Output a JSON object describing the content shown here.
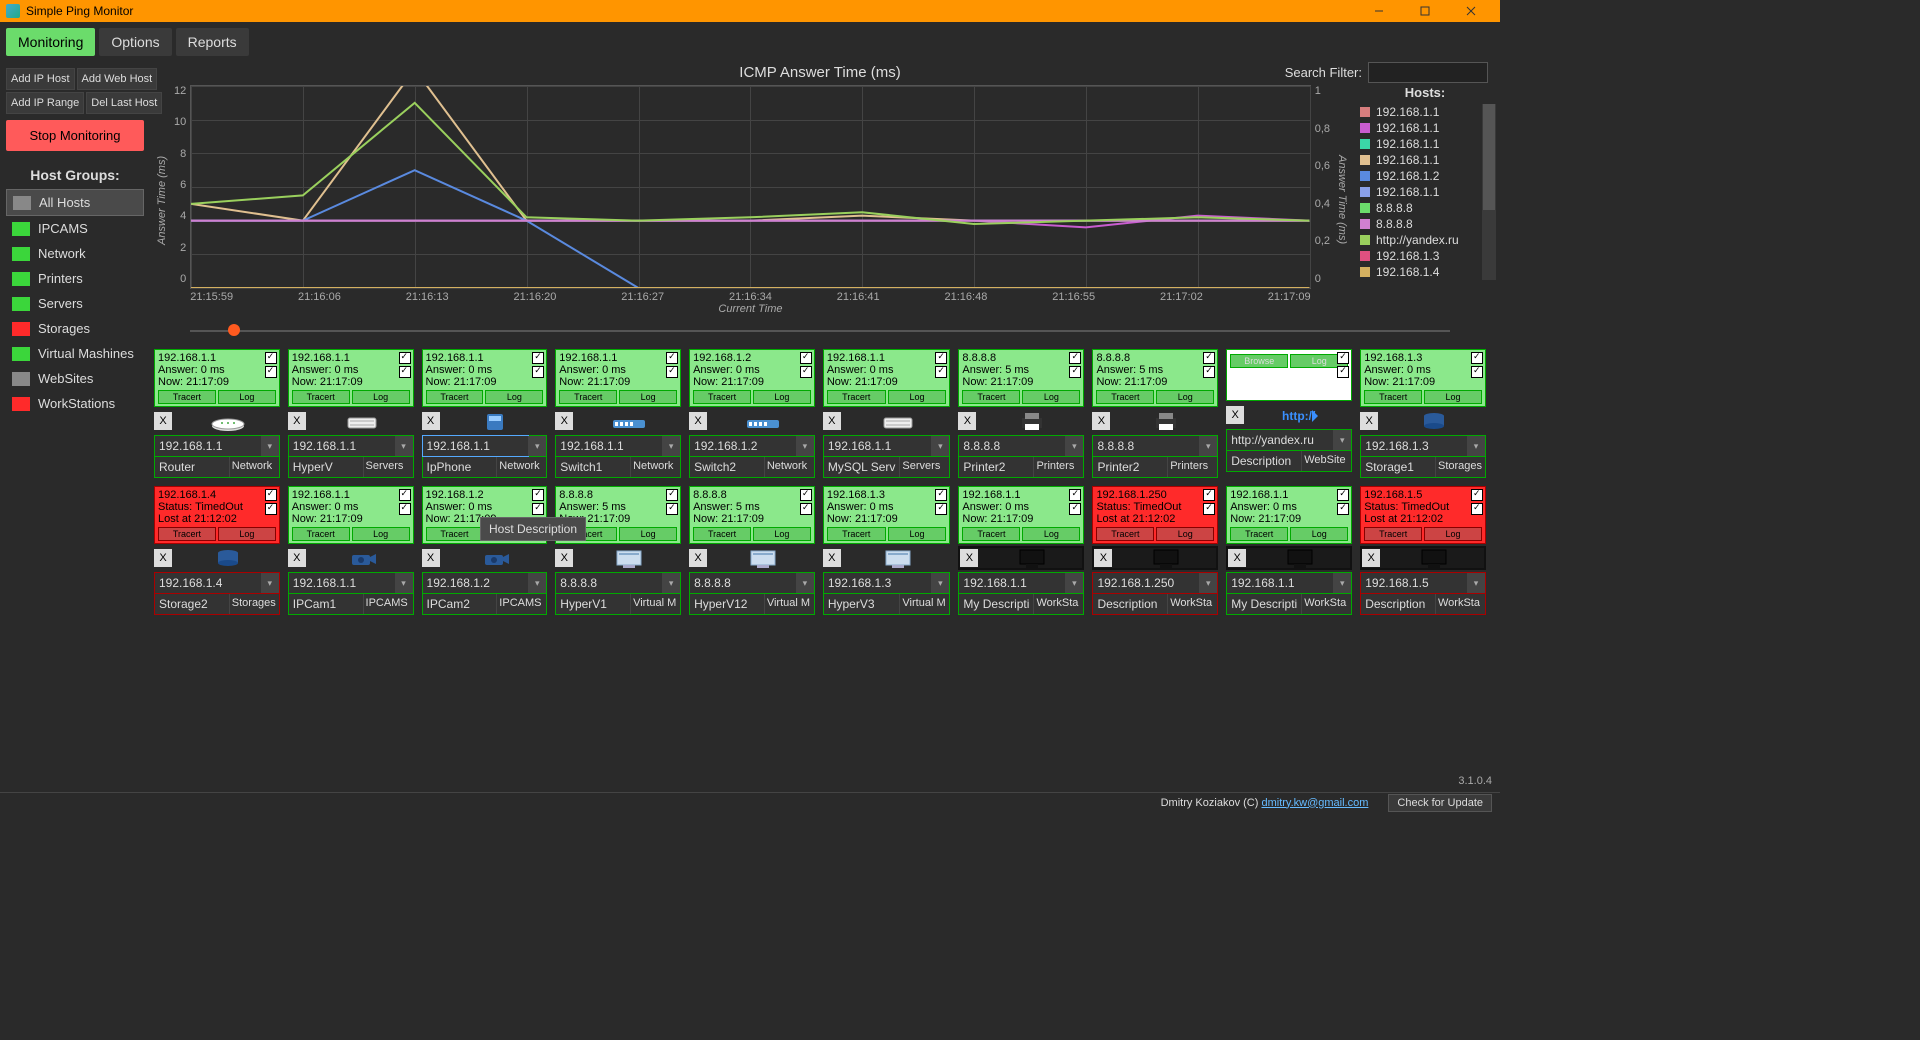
{
  "window": {
    "title": "Simple Ping Monitor"
  },
  "tabs": [
    "Monitoring",
    "Options",
    "Reports"
  ],
  "active_tab": 0,
  "toolbar": {
    "add_ip_host": "Add IP Host",
    "add_web_host": "Add Web Host",
    "add_ip_range": "Add IP Range",
    "del_last_host": "Del Last Host",
    "stop": "Stop Monitoring"
  },
  "search_label": "Search Filter:",
  "search_value": "",
  "groups_title": "Host Groups:",
  "groups": [
    {
      "name": "All Hosts",
      "color": "gray",
      "selected": true
    },
    {
      "name": "IPCAMS",
      "color": "green"
    },
    {
      "name": "Network",
      "color": "green"
    },
    {
      "name": "Printers",
      "color": "green"
    },
    {
      "name": "Servers",
      "color": "green"
    },
    {
      "name": "Storages",
      "color": "red"
    },
    {
      "name": "Virtual Mashines",
      "color": "green"
    },
    {
      "name": "WebSites",
      "color": "gray"
    },
    {
      "name": "WorkStations",
      "color": "red"
    }
  ],
  "chart": {
    "title": "ICMP Answer Time (ms)",
    "y_label_left": "Answer Time (ms)",
    "y_label_right": "Answer Time (ms)",
    "x_label": "Current Time"
  },
  "chart_data": {
    "type": "line",
    "xlabel": "Current Time",
    "ylabel_left": "Answer Time (ms)",
    "ylabel_right": "Answer Time (ms)",
    "x": [
      "21:15:59",
      "21:16:06",
      "21:16:13",
      "21:16:20",
      "21:16:27",
      "21:16:34",
      "21:16:41",
      "21:16:48",
      "21:16:55",
      "21:17:02",
      "21:17:09"
    ],
    "ylim_left": [
      0,
      12
    ],
    "ylim_right": [
      0,
      1
    ],
    "y_ticks_left": [
      0,
      2,
      4,
      6,
      8,
      10,
      12
    ],
    "y_ticks_right": [
      0,
      0.2,
      0.4,
      0.6,
      0.8,
      1
    ],
    "series": [
      {
        "name": "192.168.1.1",
        "color": "#d77e7e",
        "values": [
          4,
          4,
          4,
          4,
          4,
          4,
          4,
          4,
          4,
          4,
          4
        ]
      },
      {
        "name": "192.168.1.1",
        "color": "#c95dd0",
        "values": [
          4,
          4,
          4,
          4,
          4,
          4,
          4,
          4,
          3.6,
          4.3,
          4
        ]
      },
      {
        "name": "192.168.1.1",
        "color": "#3bd6a8",
        "values": [
          0,
          0,
          0,
          0,
          0,
          0,
          0,
          0,
          0,
          0,
          0
        ]
      },
      {
        "name": "192.168.1.1",
        "color": "#e0c090",
        "values": [
          5,
          4,
          13,
          4,
          4,
          4,
          4.3,
          4,
          4,
          4,
          4
        ]
      },
      {
        "name": "192.168.1.2",
        "color": "#5a8adf",
        "values": [
          4,
          4,
          7,
          4,
          0,
          0,
          0,
          0,
          0,
          0,
          0
        ]
      },
      {
        "name": "192.168.1.1",
        "color": "#8aa0e8",
        "values": [
          4,
          4,
          4,
          4,
          4,
          4,
          4,
          4,
          4,
          4,
          4
        ]
      },
      {
        "name": "8.8.8.8",
        "color": "#6bdc6b",
        "values": [
          0,
          0,
          0,
          0,
          0,
          0,
          0,
          0,
          0,
          0,
          0
        ]
      },
      {
        "name": "8.8.8.8",
        "color": "#d080d0",
        "values": [
          4,
          4,
          4,
          4,
          4,
          4,
          4,
          4,
          4,
          4,
          4
        ]
      },
      {
        "name": "http://yandex.ru",
        "color": "#9ad05d",
        "values": [
          5,
          5.5,
          11,
          4.2,
          4,
          4.2,
          4.5,
          3.8,
          4,
          4.2,
          4
        ]
      },
      {
        "name": "192.168.1.3",
        "color": "#e05080",
        "values": [
          0,
          0,
          0,
          0,
          0,
          0,
          0,
          0,
          0,
          0,
          0
        ]
      },
      {
        "name": "192.168.1.4",
        "color": "#d4b060",
        "values": [
          0,
          0,
          0,
          0,
          0,
          0,
          0,
          0,
          0,
          0,
          0
        ]
      }
    ]
  },
  "legend_title": "Hosts:",
  "slider_value": 3.5,
  "hosts_row1": [
    {
      "ip": "192.168.1.1",
      "ans": "Answer: 0 ms",
      "now": "Now: 21:17:09",
      "desc": "Router",
      "grp": "Network",
      "icon": "router",
      "ok": true
    },
    {
      "ip": "192.168.1.1",
      "ans": "Answer: 0 ms",
      "now": "Now: 21:17:09",
      "desc": "HyperV",
      "grp": "Servers",
      "icon": "server",
      "ok": true
    },
    {
      "ip": "192.168.1.1",
      "ans": "Answer: 0 ms",
      "now": "Now: 21:17:09",
      "desc": "IpPhone",
      "grp": "Network",
      "icon": "phone",
      "ok": true,
      "sel": true
    },
    {
      "ip": "192.168.1.1",
      "ans": "Answer: 0 ms",
      "now": "Now: 21:17:09",
      "desc": "Switch1",
      "grp": "Network",
      "icon": "switch",
      "ok": true
    },
    {
      "ip": "192.168.1.2",
      "ans": "Answer: 0 ms",
      "now": "Now: 21:17:09",
      "desc": "Switch2",
      "grp": "Network",
      "icon": "switch",
      "ok": true
    },
    {
      "ip": "192.168.1.1",
      "ans": "Answer: 0 ms",
      "now": "Now: 21:17:09",
      "desc": "MySQL Serv",
      "grp": "Servers",
      "icon": "server",
      "ok": true
    },
    {
      "ip": "8.8.8.8",
      "ans": "Answer: 5 ms",
      "now": "Now: 21:17:09",
      "desc": "Printer2",
      "grp": "Printers",
      "icon": "printer",
      "ok": true
    },
    {
      "ip": "8.8.8.8",
      "ans": "Answer: 5 ms",
      "now": "Now: 21:17:09",
      "desc": "Printer2",
      "grp": "Printers",
      "icon": "printer",
      "ok": true
    },
    {
      "ip": "http://yandex.ru",
      "ans": "",
      "now": "",
      "desc": "Description",
      "grp": "WebSite",
      "icon": "web",
      "ok": true,
      "blank": true,
      "browse": true
    },
    {
      "ip": "192.168.1.3",
      "ans": "Answer: 0 ms",
      "now": "Now: 21:17:09",
      "desc": "Storage1",
      "grp": "Storages",
      "icon": "storage",
      "ok": true
    }
  ],
  "hosts_row2": [
    {
      "ip": "192.168.1.4",
      "ans": "Status: TimedOut",
      "now": "Lost at 21:12:02",
      "desc": "Storage2",
      "grp": "Storages",
      "icon": "storage",
      "ok": false
    },
    {
      "ip": "192.168.1.1",
      "ans": "Answer: 0 ms",
      "now": "Now: 21:17:09",
      "desc": "IPCam1",
      "grp": "IPCAMS",
      "icon": "cam",
      "ok": true
    },
    {
      "ip": "192.168.1.2",
      "ans": "Answer: 0 ms",
      "now": "Now: 21:17:09",
      "desc": "IPCam2",
      "grp": "IPCAMS",
      "icon": "cam",
      "ok": true
    },
    {
      "ip": "8.8.8.8",
      "ans": "Answer: 5 ms",
      "now": "Now: 21:17:09",
      "desc": "HyperV1",
      "grp": "Virtual M",
      "icon": "vm",
      "ok": true
    },
    {
      "ip": "8.8.8.8",
      "ans": "Answer: 5 ms",
      "now": "Now: 21:17:09",
      "desc": "HyperV12",
      "grp": "Virtual M",
      "icon": "vm",
      "ok": true
    },
    {
      "ip": "192.168.1.3",
      "ans": "Answer: 0 ms",
      "now": "Now: 21:17:09",
      "desc": "HyperV3",
      "grp": "Virtual M",
      "icon": "vm",
      "ok": true
    },
    {
      "ip": "192.168.1.1",
      "ans": "Answer: 0 ms",
      "now": "Now: 21:17:09",
      "desc": "My Descripti",
      "grp": "WorkSta",
      "icon": "ws",
      "ok": true,
      "dark": true
    },
    {
      "ip": "192.168.1.250",
      "ans": "Status: TimedOut",
      "now": "Lost at 21:12:02",
      "desc": "Description",
      "grp": "WorkSta",
      "icon": "ws",
      "ok": false,
      "dark": true
    },
    {
      "ip": "192.168.1.1",
      "ans": "Answer: 0 ms",
      "now": "Now: 21:17:09",
      "desc": "My Descripti",
      "grp": "WorkSta",
      "icon": "ws",
      "ok": true,
      "dark": true
    },
    {
      "ip": "192.168.1.5",
      "ans": "Status: TimedOut",
      "now": "Lost at 21:12:02",
      "desc": "Description",
      "grp": "WorkSta",
      "icon": "ws",
      "ok": false,
      "dark": true
    }
  ],
  "btn_tracert": "Tracert",
  "btn_log": "Log",
  "btn_browse": "Browse",
  "btn_x": "X",
  "tooltip": "Host Description",
  "version": "3.1.0.4",
  "footer_author": "Dmitry Koziakov (C)",
  "footer_email": "dmitry.kw@gmail.com",
  "footer_update": "Check for Update"
}
